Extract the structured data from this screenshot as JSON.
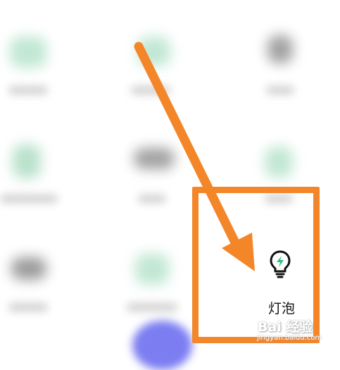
{
  "colors": {
    "accent_orange": "#f4862a",
    "bulb_green": "#27c07a",
    "blurred_icon_green": "#8fd4b0",
    "blurred_icon_dark": "#4a4a4a",
    "fab_blue": "#6d6ff0"
  },
  "grid": {
    "blurred_tiles": [
      {
        "icon": "blurred-green-icon"
      },
      {
        "icon": "blurred-green-icon"
      },
      {
        "icon": "blurred-dark-icon"
      },
      {
        "icon": "blurred-green-icon"
      },
      {
        "icon": "blurred-dark-icon"
      },
      {
        "icon": "blurred-green-icon"
      },
      {
        "icon": "blurred-dark-icon"
      },
      {
        "icon": "blurred-green-icon"
      }
    ],
    "highlighted_tile": {
      "icon": "lightbulb-icon",
      "label": "灯泡"
    }
  },
  "watermark": {
    "text": "Bai 经验",
    "url": "jingyan.baidu.com"
  }
}
